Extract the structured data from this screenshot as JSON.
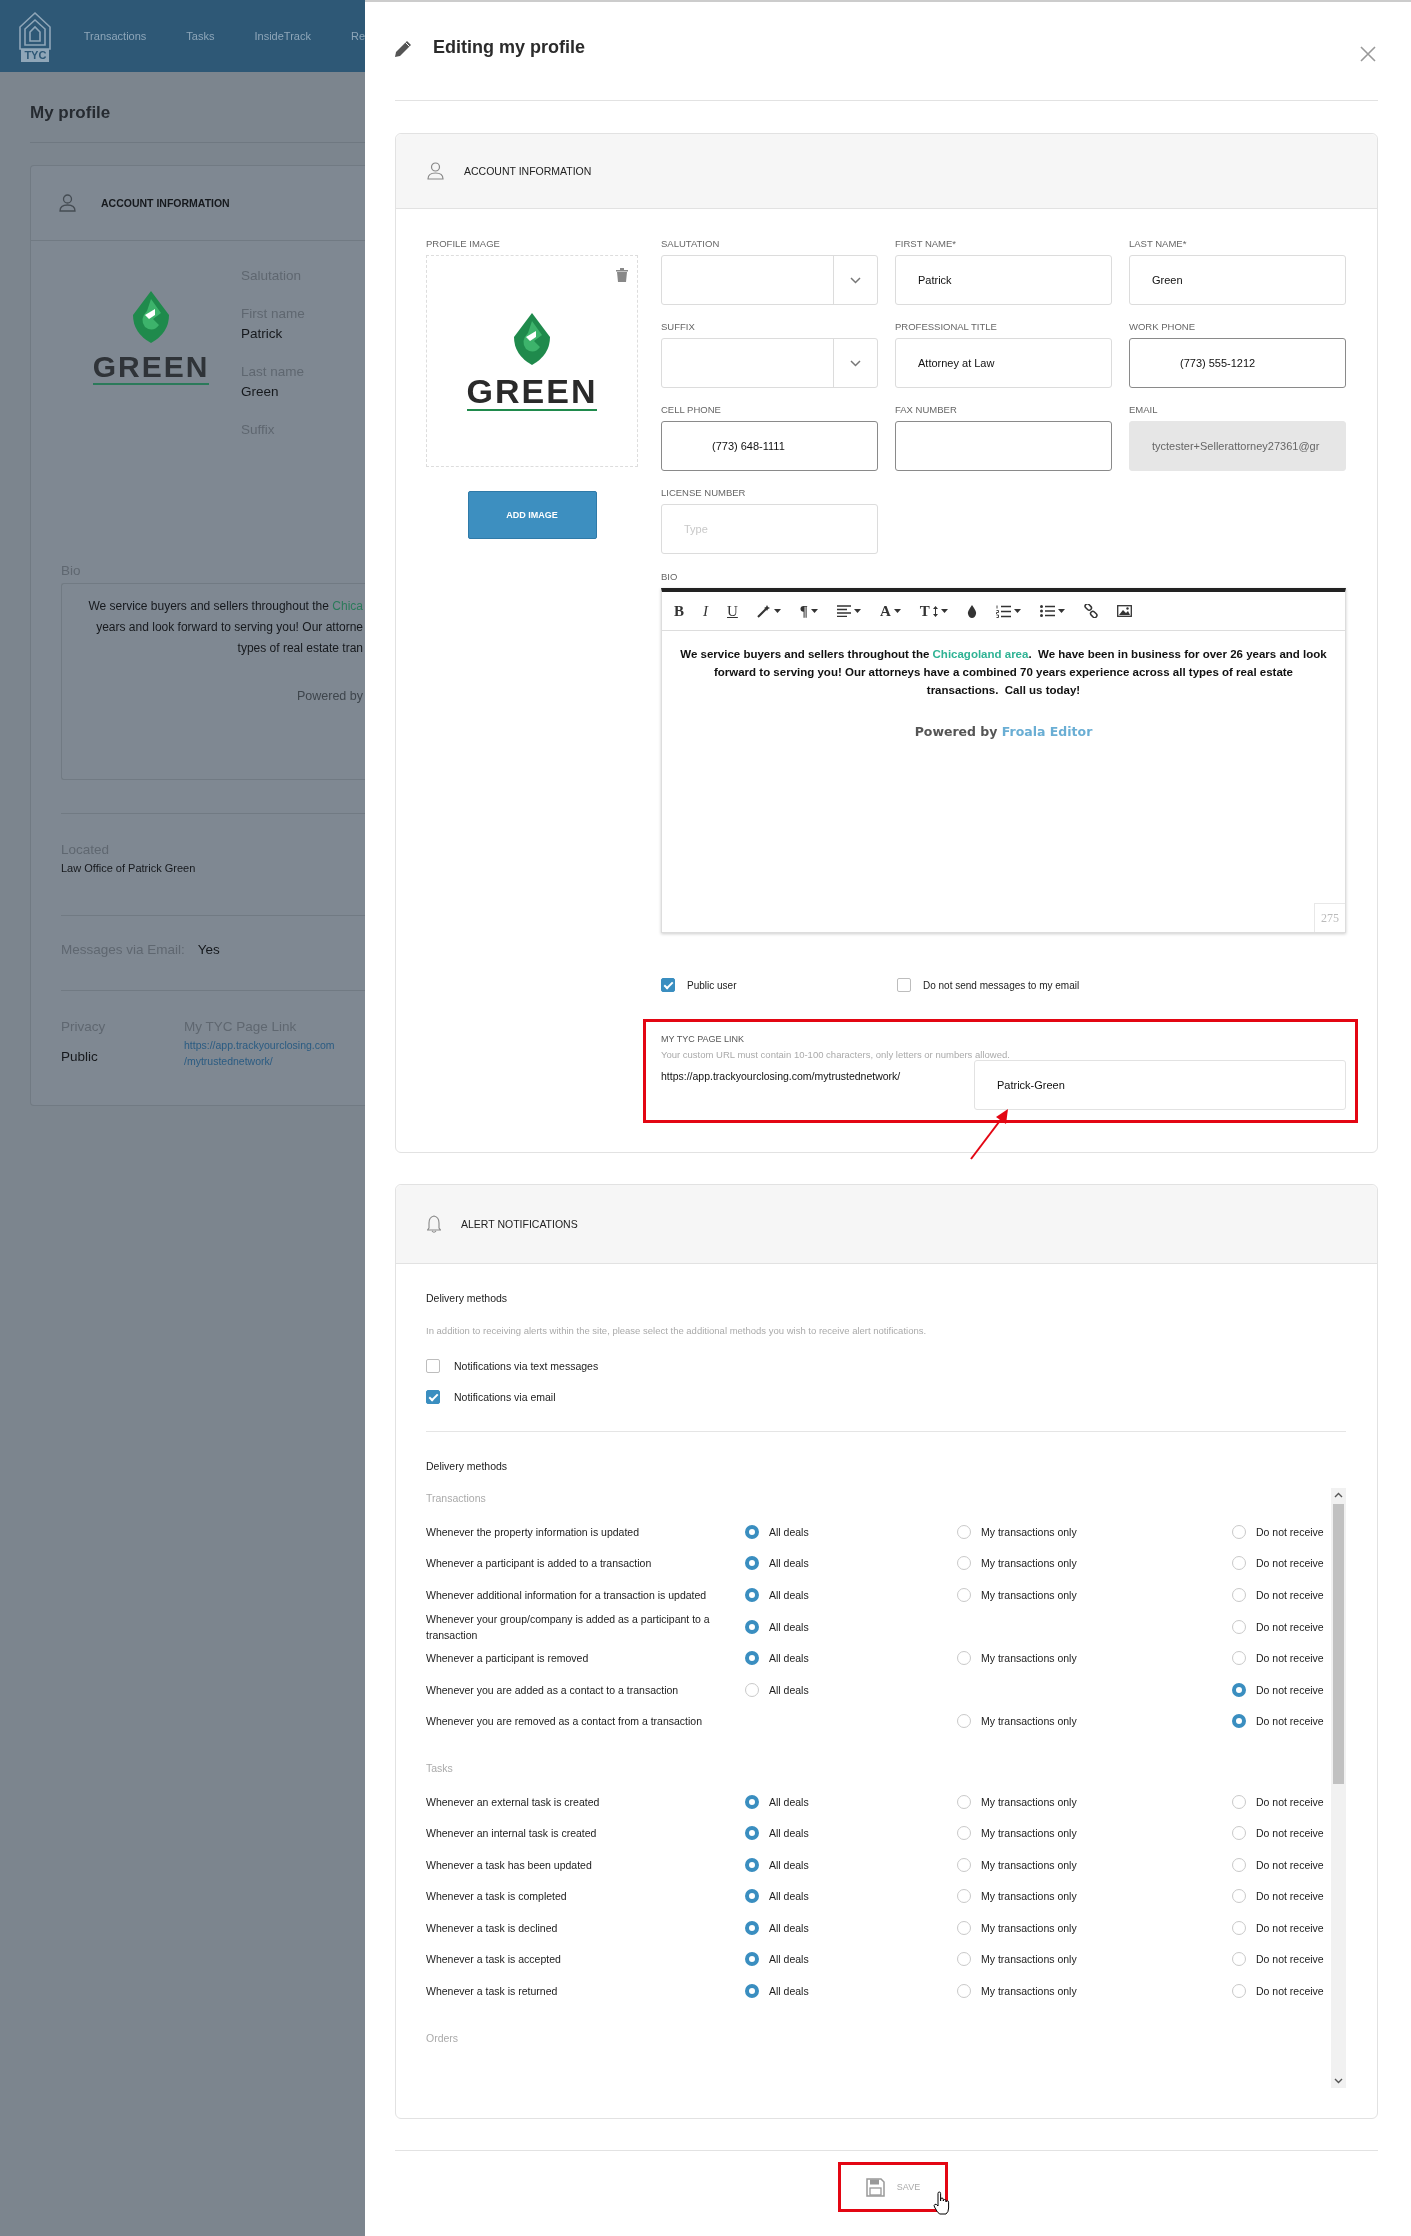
{
  "background_page": {
    "logo_text": "TYC",
    "nav": [
      "Transactions",
      "Tasks",
      "InsideTrack",
      "Re"
    ],
    "title": "My profile",
    "account_card": {
      "header": "ACCOUNT INFORMATION",
      "logo_text": "GREEN",
      "fields": [
        {
          "label": "Salutation"
        },
        {
          "label": "First name",
          "value": "Patrick"
        },
        {
          "label": "Last name",
          "value": "Green"
        },
        {
          "label": "Suffix"
        }
      ],
      "bio_label": "Bio",
      "bio_lines": [
        [
          {
            "kind": "plain",
            "text": "We service buyers and sellers throughout the "
          },
          {
            "kind": "link",
            "text": "Chica"
          }
        ],
        [
          {
            "kind": "plain",
            "text": "years and look forward to serving you! Our attorne"
          }
        ],
        [
          {
            "kind": "plain",
            "text": "types of real estate tran"
          }
        ]
      ],
      "bio_powered": "Powered by",
      "located_label": "Located",
      "located_value": "Law Office of Patrick Green",
      "messages_label": "Messages via Email:",
      "messages_value": "Yes",
      "privacy_label": "Privacy",
      "privacy_value": "Public",
      "page_link_label": "My TYC Page Link",
      "page_link_lines": [
        "https://app.trackyourclosing.com",
        "/mytrustednetwork/"
      ]
    }
  },
  "drawer": {
    "title": "Editing my profile",
    "account": {
      "header": "ACCOUNT INFORMATION",
      "profile_image_label": "PROFILE IMAGE",
      "logo_text": "GREEN",
      "add_image": "ADD IMAGE",
      "fields": [
        {
          "kind": "select",
          "label": "SALUTATION"
        },
        {
          "kind": "text",
          "label": "FIRST NAME*",
          "value": "Patrick",
          "disabled": false
        },
        {
          "kind": "text",
          "label": "LAST NAME*",
          "value": "Green",
          "disabled": false
        },
        {
          "kind": "select",
          "label": "SUFFIX"
        },
        {
          "kind": "text",
          "label": "PROFESSIONAL TITLE",
          "value": "Attorney at Law",
          "disabled": false
        },
        {
          "kind": "phone",
          "label": "WORK PHONE",
          "value": "(773) 555-1212",
          "disabled": false
        },
        {
          "kind": "phone",
          "label": "CELL PHONE",
          "value": "(773) 648-1111",
          "disabled": false
        },
        {
          "kind": "phone",
          "label": "FAX NUMBER",
          "disabled": false
        },
        {
          "kind": "text",
          "label": "EMAIL",
          "value": "tyctester+Sellerattorney27361@gr",
          "disabled": true
        },
        {
          "kind": "text",
          "label": "LICENSE NUMBER",
          "placeholder": "Type",
          "disabled": false
        }
      ],
      "bio_label": "BIO",
      "toolbar": [
        {
          "kind": "bold",
          "label": "B"
        },
        {
          "kind": "italic",
          "label": "I"
        },
        {
          "kind": "underline",
          "label": "U"
        },
        {
          "kind": "style"
        },
        {
          "kind": "paragraph",
          "label": "¶"
        },
        {
          "kind": "align"
        },
        {
          "kind": "font_family",
          "label": "A"
        },
        {
          "kind": "font_size",
          "label": "T"
        },
        {
          "kind": "color"
        },
        {
          "kind": "ordered_list"
        },
        {
          "kind": "unordered_list"
        },
        {
          "kind": "link"
        },
        {
          "kind": "image"
        }
      ],
      "bio": [
        {
          "kind": "plain",
          "text": "We service buyers and sellers throughout the "
        },
        {
          "kind": "link",
          "text": "Chicagoland area"
        },
        {
          "kind": "plain",
          "text": ".  We have been in business for over 26 years and look forward to serving you! Our attorneys have a combined 70 years experience across all types of real estate transactions.  Call us today!"
        }
      ],
      "powered": [
        {
          "kind": "plain",
          "text": "Powered by "
        },
        {
          "kind": "link",
          "text": "Froala Editor"
        }
      ],
      "char_count": "275",
      "checkboxes": [
        {
          "label": "Public user",
          "checked": true
        },
        {
          "label": "Do not send messages to my email",
          "checked": false
        }
      ],
      "page_link": {
        "label": "MY TYC PAGE LINK",
        "hint": "Your custom URL must contain 10-100 characters, only letters or numbers allowed.",
        "prefix": "https://app.trackyourclosing.com/mytrustednetwork/",
        "value": "Patrick-Green"
      }
    },
    "alerts": {
      "header": "ALERT NOTIFICATIONS",
      "delivery_title": "Delivery methods",
      "delivery_hint": "In addition to receiving alerts within the site, please select the additional methods you wish to receive alert notifications.",
      "methods": [
        {
          "label": "Notifications via text messages",
          "checked": false
        },
        {
          "label": "Notifications via email",
          "checked": true
        }
      ],
      "settings_title": "Delivery methods",
      "groups": [
        {
          "title": "Transactions",
          "rows": [
            {
              "text": "Whenever the property information is updated",
              "options": [
                {
                  "kind": "all",
                  "label": "All deals",
                  "selected": true
                },
                {
                  "kind": "mine",
                  "label": "My transactions only",
                  "selected": false
                },
                {
                  "kind": "none",
                  "label": "Do not receive",
                  "selected": false
                }
              ]
            },
            {
              "text": "Whenever a participant is added to a transaction",
              "options": [
                {
                  "kind": "all",
                  "label": "All deals",
                  "selected": true
                },
                {
                  "kind": "mine",
                  "label": "My transactions only",
                  "selected": false
                },
                {
                  "kind": "none",
                  "label": "Do not receive",
                  "selected": false
                }
              ]
            },
            {
              "text": "Whenever additional information for a transaction is updated",
              "options": [
                {
                  "kind": "all",
                  "label": "All deals",
                  "selected": true
                },
                {
                  "kind": "mine",
                  "label": "My transactions only",
                  "selected": false
                },
                {
                  "kind": "none",
                  "label": "Do not receive",
                  "selected": false
                }
              ]
            },
            {
              "text": "Whenever your group/company is added as a participant to a transaction",
              "options": [
                {
                  "kind": "all",
                  "label": "All deals",
                  "selected": true
                },
                {
                  "kind": "none",
                  "label": "Do not receive",
                  "selected": false
                }
              ]
            },
            {
              "text": "Whenever a participant is removed",
              "options": [
                {
                  "kind": "all",
                  "label": "All deals",
                  "selected": true
                },
                {
                  "kind": "mine",
                  "label": "My transactions only",
                  "selected": false
                },
                {
                  "kind": "none",
                  "label": "Do not receive",
                  "selected": false
                }
              ]
            },
            {
              "text": "Whenever you are added as a contact to a transaction",
              "options": [
                {
                  "kind": "all",
                  "label": "All deals",
                  "selected": false
                },
                {
                  "kind": "none",
                  "label": "Do not receive",
                  "selected": true
                }
              ]
            },
            {
              "text": "Whenever you are removed as a contact from a transaction",
              "options": [
                {
                  "kind": "mine",
                  "label": "My transactions only",
                  "selected": false
                },
                {
                  "kind": "none",
                  "label": "Do not receive",
                  "selected": true
                }
              ]
            }
          ]
        },
        {
          "title": "Tasks",
          "rows": [
            {
              "text": "Whenever an external task is created",
              "options": [
                {
                  "kind": "all",
                  "label": "All deals",
                  "selected": true
                },
                {
                  "kind": "mine",
                  "label": "My transactions only",
                  "selected": false
                },
                {
                  "kind": "none",
                  "label": "Do not receive",
                  "selected": false
                }
              ]
            },
            {
              "text": "Whenever an internal task is created",
              "options": [
                {
                  "kind": "all",
                  "label": "All deals",
                  "selected": true
                },
                {
                  "kind": "mine",
                  "label": "My transactions only",
                  "selected": false
                },
                {
                  "kind": "none",
                  "label": "Do not receive",
                  "selected": false
                }
              ]
            },
            {
              "text": "Whenever a task has been updated",
              "options": [
                {
                  "kind": "all",
                  "label": "All deals",
                  "selected": true
                },
                {
                  "kind": "mine",
                  "label": "My transactions only",
                  "selected": false
                },
                {
                  "kind": "none",
                  "label": "Do not receive",
                  "selected": false
                }
              ]
            },
            {
              "text": "Whenever a task is completed",
              "options": [
                {
                  "kind": "all",
                  "label": "All deals",
                  "selected": true
                },
                {
                  "kind": "mine",
                  "label": "My transactions only",
                  "selected": false
                },
                {
                  "kind": "none",
                  "label": "Do not receive",
                  "selected": false
                }
              ]
            },
            {
              "text": "Whenever a task is declined",
              "options": [
                {
                  "kind": "all",
                  "label": "All deals",
                  "selected": true
                },
                {
                  "kind": "mine",
                  "label": "My transactions only",
                  "selected": false
                },
                {
                  "kind": "none",
                  "label": "Do not receive",
                  "selected": false
                }
              ]
            },
            {
              "text": "Whenever a task is accepted",
              "options": [
                {
                  "kind": "all",
                  "label": "All deals",
                  "selected": true
                },
                {
                  "kind": "mine",
                  "label": "My transactions only",
                  "selected": false
                },
                {
                  "kind": "none",
                  "label": "Do not receive",
                  "selected": false
                }
              ]
            },
            {
              "text": "Whenever a task is returned",
              "options": [
                {
                  "kind": "all",
                  "label": "All deals",
                  "selected": true
                },
                {
                  "kind": "mine",
                  "label": "My transactions only",
                  "selected": false
                },
                {
                  "kind": "none",
                  "label": "Do not receive",
                  "selected": false
                }
              ]
            }
          ]
        },
        {
          "title": "Orders"
        }
      ]
    },
    "save": "SAVE"
  }
}
